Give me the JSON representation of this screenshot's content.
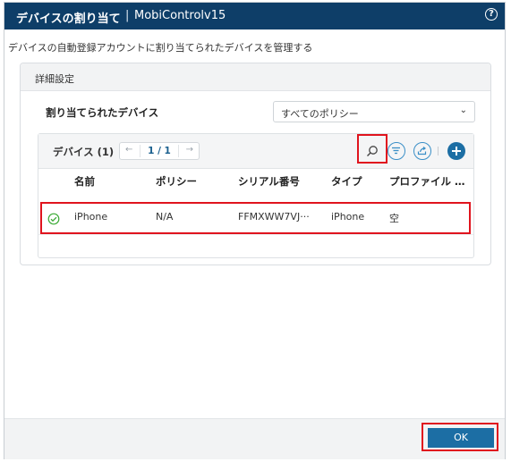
{
  "dialog": {
    "title": "デバイスの割り当て",
    "separator": "|",
    "app_name": "MobiControlv15",
    "help_label": "?",
    "description": "デバイスの自動登録アカウントに割り当てられたデバイスを管理する"
  },
  "details": {
    "section_title": "詳細設定",
    "assigned_label": "割り当てられたデバイス",
    "policy_select": {
      "value": "すべてのポリシー",
      "chevron": "⌄"
    }
  },
  "device_table": {
    "title": "デバイス (1)",
    "pager": {
      "prev": "←",
      "page": "1 / 1",
      "next": "→"
    },
    "toolbar_icons": [
      "search-icon",
      "filter-icon",
      "export-icon",
      "add-icon"
    ],
    "columns": [
      "名前",
      "ポリシー",
      "シリアル番号",
      "タイプ",
      "プロファイル …"
    ],
    "rows": [
      {
        "status": "check-icon",
        "name": "iPhone",
        "policy": "N/A",
        "serial": "FFMXWW7VJ···",
        "type": "iPhone",
        "profile": "空"
      }
    ]
  },
  "footer": {
    "ok_label": "OK"
  },
  "colors": {
    "titlebar": "#0e3e68",
    "accent": "#1c6ea4",
    "highlight": "#e0141e",
    "status_ok": "#3aaa35"
  }
}
